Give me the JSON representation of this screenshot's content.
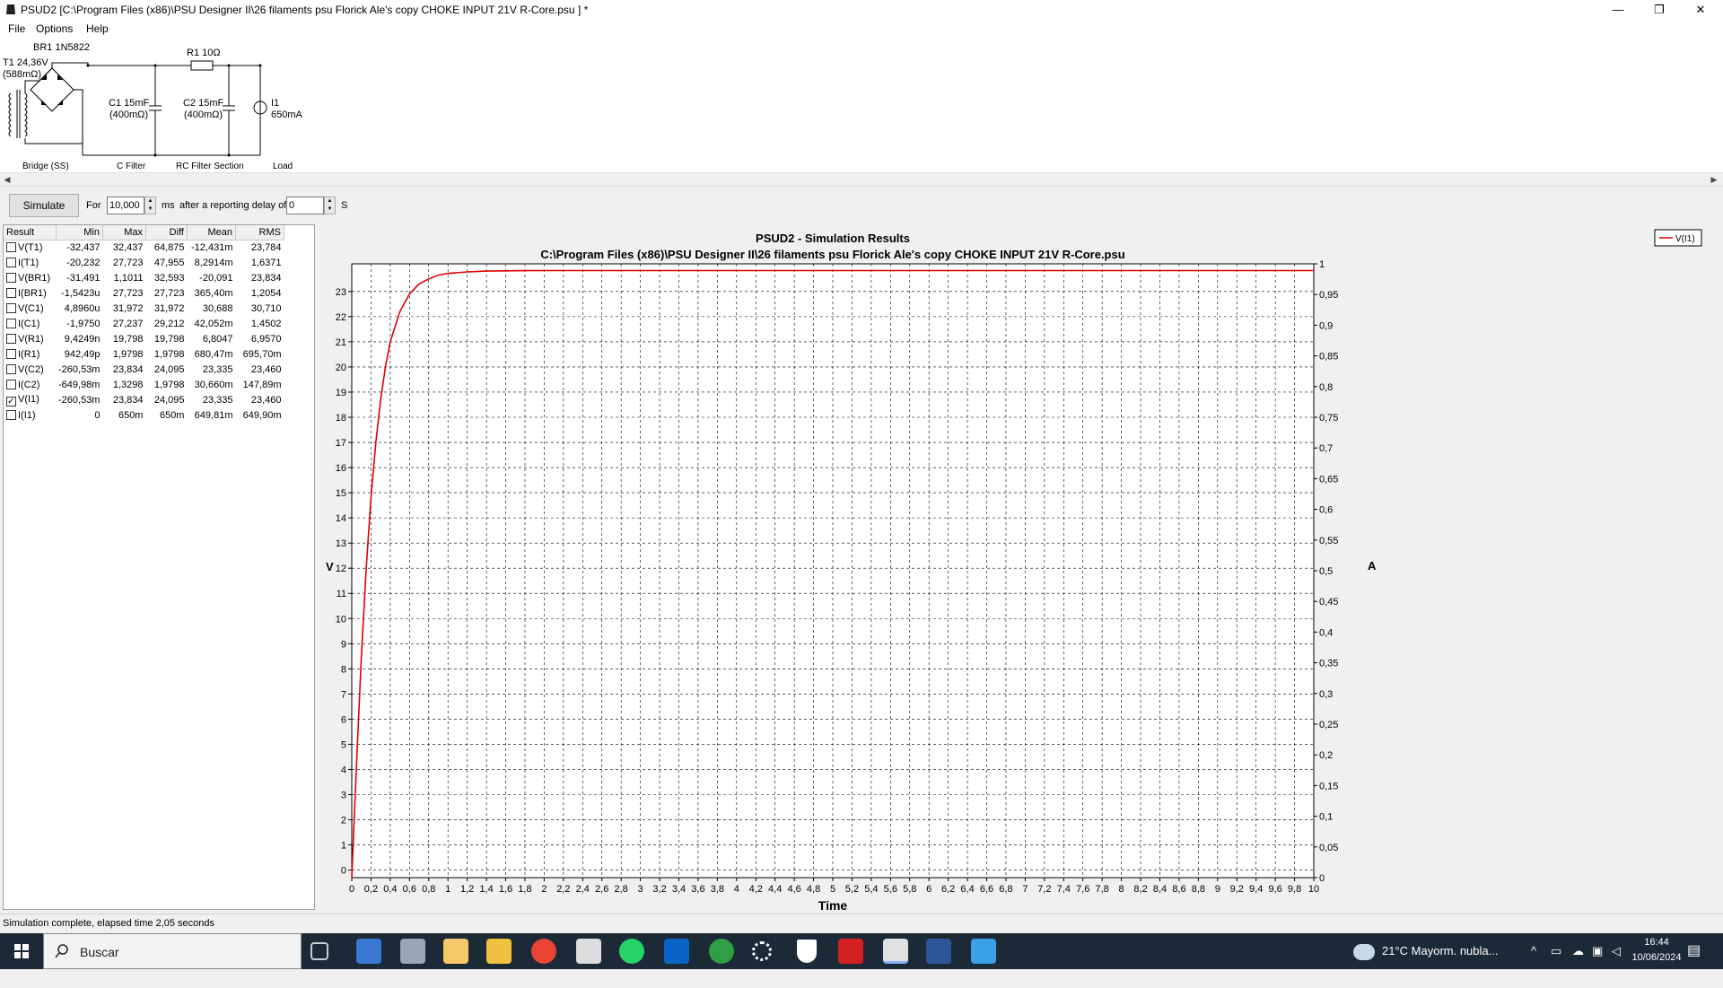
{
  "window": {
    "title": "PSUD2  [C:\\Program Files (x86)\\PSU Designer II\\26 filaments psu Florick Ale's copy CHOKE INPUT 21V R-Core.psu ] *",
    "minimize": "—",
    "maximize": "❐",
    "close": "✕"
  },
  "menu": [
    "File",
    "Options",
    "Help"
  ],
  "schematic": {
    "t1_label": "T1 24,36V",
    "t1_res": "(588mΩ)",
    "br1_label": "BR1 1N5822",
    "r1_label": "R1 10Ω",
    "c1_label": "C1 15mF",
    "c1_res": "(400mΩ)",
    "c2_label": "C2 15mF",
    "c2_res": "(400mΩ)",
    "i1_label": "I1",
    "i1_value": "650mA",
    "section_bridge": "Bridge (SS)",
    "section_cfilter": "C Filter",
    "section_rc": "RC Filter Section",
    "section_load": "Load"
  },
  "controls": {
    "simulate": "Simulate",
    "for_label": "For",
    "duration": "10,000",
    "ms_label": "ms",
    "delay_label": "after a reporting delay of",
    "delay": "0",
    "s_label": "S"
  },
  "results": {
    "headers": [
      "Result",
      "Min",
      "Max",
      "Diff",
      "Mean",
      "RMS"
    ],
    "rows": [
      {
        "name": "V(T1)",
        "checked": false,
        "min": "-32,437",
        "max": "32,437",
        "diff": "64,875",
        "mean": "-12,431m",
        "rms": "23,784"
      },
      {
        "name": "I(T1)",
        "checked": false,
        "min": "-20,232",
        "max": "27,723",
        "diff": "47,955",
        "mean": "8,2914m",
        "rms": "1,6371"
      },
      {
        "name": "V(BR1)",
        "checked": false,
        "min": "-31,491",
        "max": "1,1011",
        "diff": "32,593",
        "mean": "-20,091",
        "rms": "23,834"
      },
      {
        "name": "I(BR1)",
        "checked": false,
        "min": "-1,5423u",
        "max": "27,723",
        "diff": "27,723",
        "mean": "365,40m",
        "rms": "1,2054"
      },
      {
        "name": "V(C1)",
        "checked": false,
        "min": "4,8960u",
        "max": "31,972",
        "diff": "31,972",
        "mean": "30,688",
        "rms": "30,710"
      },
      {
        "name": "I(C1)",
        "checked": false,
        "min": "-1,9750",
        "max": "27,237",
        "diff": "29,212",
        "mean": "42,052m",
        "rms": "1,4502"
      },
      {
        "name": "V(R1)",
        "checked": false,
        "min": "9,4249n",
        "max": "19,798",
        "diff": "19,798",
        "mean": "6,8047",
        "rms": "6,9570"
      },
      {
        "name": "I(R1)",
        "checked": false,
        "min": "942,49p",
        "max": "1,9798",
        "diff": "1,9798",
        "mean": "680,47m",
        "rms": "695,70m"
      },
      {
        "name": "V(C2)",
        "checked": false,
        "min": "-260,53m",
        "max": "23,834",
        "diff": "24,095",
        "mean": "23,335",
        "rms": "23,460"
      },
      {
        "name": "I(C2)",
        "checked": false,
        "min": "-649,98m",
        "max": "1,3298",
        "diff": "1,9798",
        "mean": "30,660m",
        "rms": "147,89m"
      },
      {
        "name": "V(I1)",
        "checked": true,
        "min": "-260,53m",
        "max": "23,834",
        "diff": "24,095",
        "mean": "23,335",
        "rms": "23,460"
      },
      {
        "name": "I(I1)",
        "checked": false,
        "min": "0",
        "max": "650m",
        "diff": "650m",
        "mean": "649,81m",
        "rms": "649,90m"
      }
    ]
  },
  "chart_data": {
    "type": "line",
    "title": "PSUD2 - Simulation Results",
    "subtitle": "C:\\Program Files (x86)\\PSU Designer II\\26 filaments psu Florick Ale's copy CHOKE INPUT 21V R-Core.psu",
    "xlabel": "Time",
    "ylabel": "V",
    "y2label": "A",
    "xlim": [
      0,
      10
    ],
    "ylim": [
      -0.3,
      24.1
    ],
    "y2lim": [
      0,
      1
    ],
    "grid": true,
    "legend_position": "top-right",
    "x_ticks": [
      "0",
      "0,2",
      "0,4",
      "0,6",
      "0,8",
      "1",
      "1,2",
      "1,4",
      "1,6",
      "1,8",
      "2",
      "2,2",
      "2,4",
      "2,6",
      "2,8",
      "3",
      "3,2",
      "3,4",
      "3,6",
      "3,8",
      "4",
      "4,2",
      "4,4",
      "4,6",
      "4,8",
      "5",
      "5,2",
      "5,4",
      "5,6",
      "5,8",
      "6",
      "6,2",
      "6,4",
      "6,6",
      "6,8",
      "7",
      "7,2",
      "7,4",
      "7,6",
      "7,8",
      "8",
      "8,2",
      "8,4",
      "8,6",
      "8,8",
      "9",
      "9,2",
      "9,4",
      "9,6",
      "9,8",
      "10"
    ],
    "y_ticks": [
      "0",
      "1",
      "2",
      "3",
      "4",
      "5",
      "6",
      "7",
      "8",
      "9",
      "10",
      "11",
      "12",
      "13",
      "14",
      "15",
      "16",
      "17",
      "18",
      "19",
      "20",
      "21",
      "22",
      "23"
    ],
    "y2_ticks": [
      "0",
      "0,05",
      "0,1",
      "0,15",
      "0,2",
      "0,25",
      "0,3",
      "0,35",
      "0,4",
      "0,45",
      "0,5",
      "0,55",
      "0,6",
      "0,65",
      "0,7",
      "0,75",
      "0,8",
      "0,85",
      "0,9",
      "0,95",
      "1"
    ],
    "series": [
      {
        "name": "V(I1)",
        "color": "#e00000",
        "x": [
          0,
          0.02,
          0.05,
          0.1,
          0.15,
          0.2,
          0.25,
          0.3,
          0.35,
          0.4,
          0.5,
          0.6,
          0.7,
          0.8,
          0.9,
          1.0,
          1.2,
          1.4,
          1.6,
          1.8,
          2.0,
          2.5,
          3,
          4,
          5,
          6,
          7,
          8,
          9,
          10
        ],
        "y": [
          -0.3,
          1.5,
          4.3,
          8.5,
          12.0,
          14.8,
          17.0,
          18.7,
          20.0,
          21.0,
          22.2,
          22.9,
          23.3,
          23.5,
          23.65,
          23.72,
          23.78,
          23.81,
          23.82,
          23.83,
          23.834,
          23.834,
          23.834,
          23.834,
          23.834,
          23.834,
          23.834,
          23.834,
          23.834,
          23.834
        ]
      }
    ]
  },
  "status": "Simulation complete, elapsed time 2,05 seconds",
  "taskbar": {
    "search": "Buscar",
    "weather": "21°C  Mayorm. nubla...",
    "time": "16:44",
    "date": "10/06/2024"
  }
}
